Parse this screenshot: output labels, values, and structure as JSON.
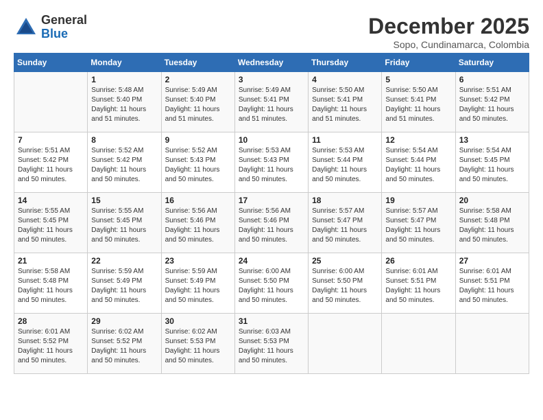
{
  "header": {
    "logo_line1": "General",
    "logo_line2": "Blue",
    "month_title": "December 2025",
    "subtitle": "Sopo, Cundinamarca, Colombia"
  },
  "weekdays": [
    "Sunday",
    "Monday",
    "Tuesday",
    "Wednesday",
    "Thursday",
    "Friday",
    "Saturday"
  ],
  "weeks": [
    [
      {
        "day": "",
        "info": ""
      },
      {
        "day": "1",
        "info": "Sunrise: 5:48 AM\nSunset: 5:40 PM\nDaylight: 11 hours\nand 51 minutes."
      },
      {
        "day": "2",
        "info": "Sunrise: 5:49 AM\nSunset: 5:40 PM\nDaylight: 11 hours\nand 51 minutes."
      },
      {
        "day": "3",
        "info": "Sunrise: 5:49 AM\nSunset: 5:41 PM\nDaylight: 11 hours\nand 51 minutes."
      },
      {
        "day": "4",
        "info": "Sunrise: 5:50 AM\nSunset: 5:41 PM\nDaylight: 11 hours\nand 51 minutes."
      },
      {
        "day": "5",
        "info": "Sunrise: 5:50 AM\nSunset: 5:41 PM\nDaylight: 11 hours\nand 51 minutes."
      },
      {
        "day": "6",
        "info": "Sunrise: 5:51 AM\nSunset: 5:42 PM\nDaylight: 11 hours\nand 50 minutes."
      }
    ],
    [
      {
        "day": "7",
        "info": "Sunrise: 5:51 AM\nSunset: 5:42 PM\nDaylight: 11 hours\nand 50 minutes."
      },
      {
        "day": "8",
        "info": "Sunrise: 5:52 AM\nSunset: 5:42 PM\nDaylight: 11 hours\nand 50 minutes."
      },
      {
        "day": "9",
        "info": "Sunrise: 5:52 AM\nSunset: 5:43 PM\nDaylight: 11 hours\nand 50 minutes."
      },
      {
        "day": "10",
        "info": "Sunrise: 5:53 AM\nSunset: 5:43 PM\nDaylight: 11 hours\nand 50 minutes."
      },
      {
        "day": "11",
        "info": "Sunrise: 5:53 AM\nSunset: 5:44 PM\nDaylight: 11 hours\nand 50 minutes."
      },
      {
        "day": "12",
        "info": "Sunrise: 5:54 AM\nSunset: 5:44 PM\nDaylight: 11 hours\nand 50 minutes."
      },
      {
        "day": "13",
        "info": "Sunrise: 5:54 AM\nSunset: 5:45 PM\nDaylight: 11 hours\nand 50 minutes."
      }
    ],
    [
      {
        "day": "14",
        "info": "Sunrise: 5:55 AM\nSunset: 5:45 PM\nDaylight: 11 hours\nand 50 minutes."
      },
      {
        "day": "15",
        "info": "Sunrise: 5:55 AM\nSunset: 5:45 PM\nDaylight: 11 hours\nand 50 minutes."
      },
      {
        "day": "16",
        "info": "Sunrise: 5:56 AM\nSunset: 5:46 PM\nDaylight: 11 hours\nand 50 minutes."
      },
      {
        "day": "17",
        "info": "Sunrise: 5:56 AM\nSunset: 5:46 PM\nDaylight: 11 hours\nand 50 minutes."
      },
      {
        "day": "18",
        "info": "Sunrise: 5:57 AM\nSunset: 5:47 PM\nDaylight: 11 hours\nand 50 minutes."
      },
      {
        "day": "19",
        "info": "Sunrise: 5:57 AM\nSunset: 5:47 PM\nDaylight: 11 hours\nand 50 minutes."
      },
      {
        "day": "20",
        "info": "Sunrise: 5:58 AM\nSunset: 5:48 PM\nDaylight: 11 hours\nand 50 minutes."
      }
    ],
    [
      {
        "day": "21",
        "info": "Sunrise: 5:58 AM\nSunset: 5:48 PM\nDaylight: 11 hours\nand 50 minutes."
      },
      {
        "day": "22",
        "info": "Sunrise: 5:59 AM\nSunset: 5:49 PM\nDaylight: 11 hours\nand 50 minutes."
      },
      {
        "day": "23",
        "info": "Sunrise: 5:59 AM\nSunset: 5:49 PM\nDaylight: 11 hours\nand 50 minutes."
      },
      {
        "day": "24",
        "info": "Sunrise: 6:00 AM\nSunset: 5:50 PM\nDaylight: 11 hours\nand 50 minutes."
      },
      {
        "day": "25",
        "info": "Sunrise: 6:00 AM\nSunset: 5:50 PM\nDaylight: 11 hours\nand 50 minutes."
      },
      {
        "day": "26",
        "info": "Sunrise: 6:01 AM\nSunset: 5:51 PM\nDaylight: 11 hours\nand 50 minutes."
      },
      {
        "day": "27",
        "info": "Sunrise: 6:01 AM\nSunset: 5:51 PM\nDaylight: 11 hours\nand 50 minutes."
      }
    ],
    [
      {
        "day": "28",
        "info": "Sunrise: 6:01 AM\nSunset: 5:52 PM\nDaylight: 11 hours\nand 50 minutes."
      },
      {
        "day": "29",
        "info": "Sunrise: 6:02 AM\nSunset: 5:52 PM\nDaylight: 11 hours\nand 50 minutes."
      },
      {
        "day": "30",
        "info": "Sunrise: 6:02 AM\nSunset: 5:53 PM\nDaylight: 11 hours\nand 50 minutes."
      },
      {
        "day": "31",
        "info": "Sunrise: 6:03 AM\nSunset: 5:53 PM\nDaylight: 11 hours\nand 50 minutes."
      },
      {
        "day": "",
        "info": ""
      },
      {
        "day": "",
        "info": ""
      },
      {
        "day": "",
        "info": ""
      }
    ]
  ]
}
